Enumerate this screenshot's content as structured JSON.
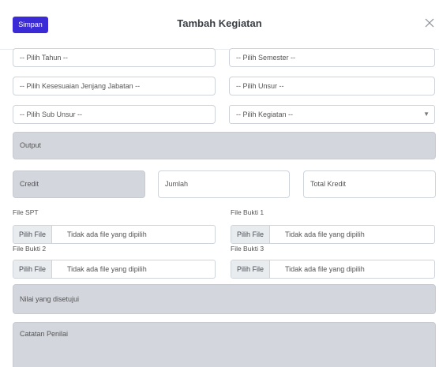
{
  "modal": {
    "title": "Tambah Kegiatan",
    "save_label": "Simpan",
    "close_icon": "close-icon"
  },
  "form": {
    "tahun": "-- Pilih Tahun --",
    "semester": "-- Pilih Semester --",
    "jenjang": "-- Pilih Kesesuaian Jenjang Jabatan --",
    "unsur": "-- Pilih Unsur --",
    "sub_unsur": "-- Pilih Sub Unsur --",
    "kegiatan": "-- Pilih Kegiatan --",
    "output": "Output",
    "credit": "Credit",
    "jumlah": "Jumlah",
    "total_kredit": "Total Kredit",
    "nilai": "Nilai yang disetujui",
    "catatan": "Catatan Penilai"
  },
  "files": {
    "spt_label": "File SPT",
    "bukti1_label": "File Bukti 1",
    "bukti2_label": "File Bukti 2",
    "bukti3_label": "File Bukti 3",
    "button_label": "Pilih File",
    "no_file_text": "Tidak ada file yang dipilih"
  },
  "colors": {
    "primary": "#3a2bd6",
    "readonly_bg": "#d3d6dc"
  }
}
